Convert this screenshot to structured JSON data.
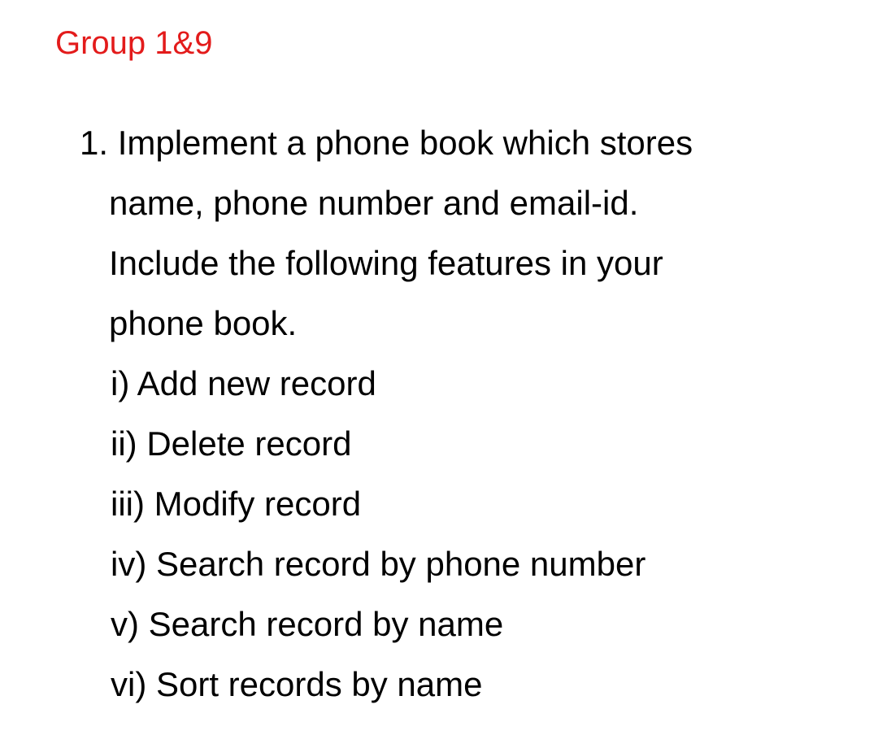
{
  "header": {
    "group_title": "Group 1&9",
    "title_color": "#e31b1b"
  },
  "question": {
    "line_1": "1. Implement a phone book which stores",
    "line_2": "name, phone number and email-id.",
    "line_3": "Include the following features in your",
    "line_4": "phone book.",
    "features": [
      "i) Add new record",
      "ii) Delete record",
      "iii) Modify record",
      "iv) Search record by phone number",
      "v) Search record by name",
      "vi) Sort records by name"
    ]
  }
}
